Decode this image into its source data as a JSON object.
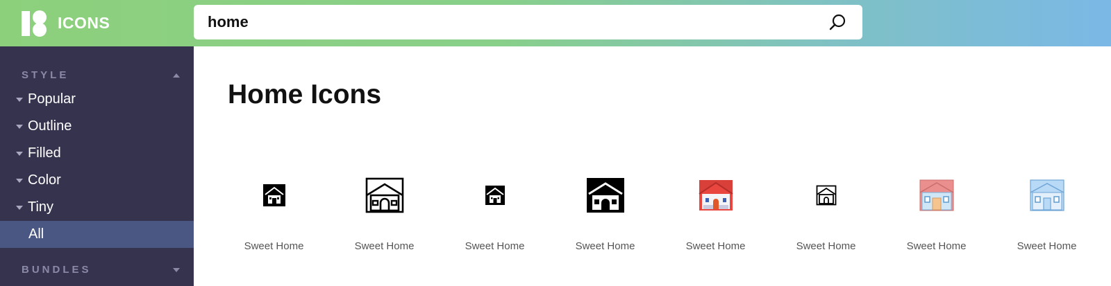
{
  "brand": {
    "name": "ICONS"
  },
  "search": {
    "value": "home",
    "icon": "search-icon"
  },
  "sidebar": {
    "style_heading": "STYLE",
    "items": [
      {
        "label": "Popular"
      },
      {
        "label": "Outline"
      },
      {
        "label": "Filled"
      },
      {
        "label": "Color"
      },
      {
        "label": "Tiny"
      },
      {
        "label": "All"
      }
    ],
    "bundles_heading": "BUNDLES"
  },
  "main": {
    "title": "Home Icons",
    "icons": [
      {
        "caption": "Sweet Home",
        "icon": "home-filled-small-icon"
      },
      {
        "caption": "Sweet Home",
        "icon": "home-outline-large-icon"
      },
      {
        "caption": "Sweet Home",
        "icon": "home-filled-tiny-icon"
      },
      {
        "caption": "Sweet Home",
        "icon": "home-filled-large-icon"
      },
      {
        "caption": "Sweet Home",
        "icon": "home-color-red-roof-icon"
      },
      {
        "caption": "Sweet Home",
        "icon": "home-outline-tiny-icon"
      },
      {
        "caption": "Sweet Home",
        "icon": "home-color-pink-roof-icon"
      },
      {
        "caption": "Sweet Home",
        "icon": "home-color-blue-icon"
      }
    ]
  },
  "colors": {
    "sidebar_bg": "#36334f",
    "sidebar_active": "#4a5783",
    "gradient_start": "#8dd07c",
    "gradient_end": "#7bb8e6"
  }
}
